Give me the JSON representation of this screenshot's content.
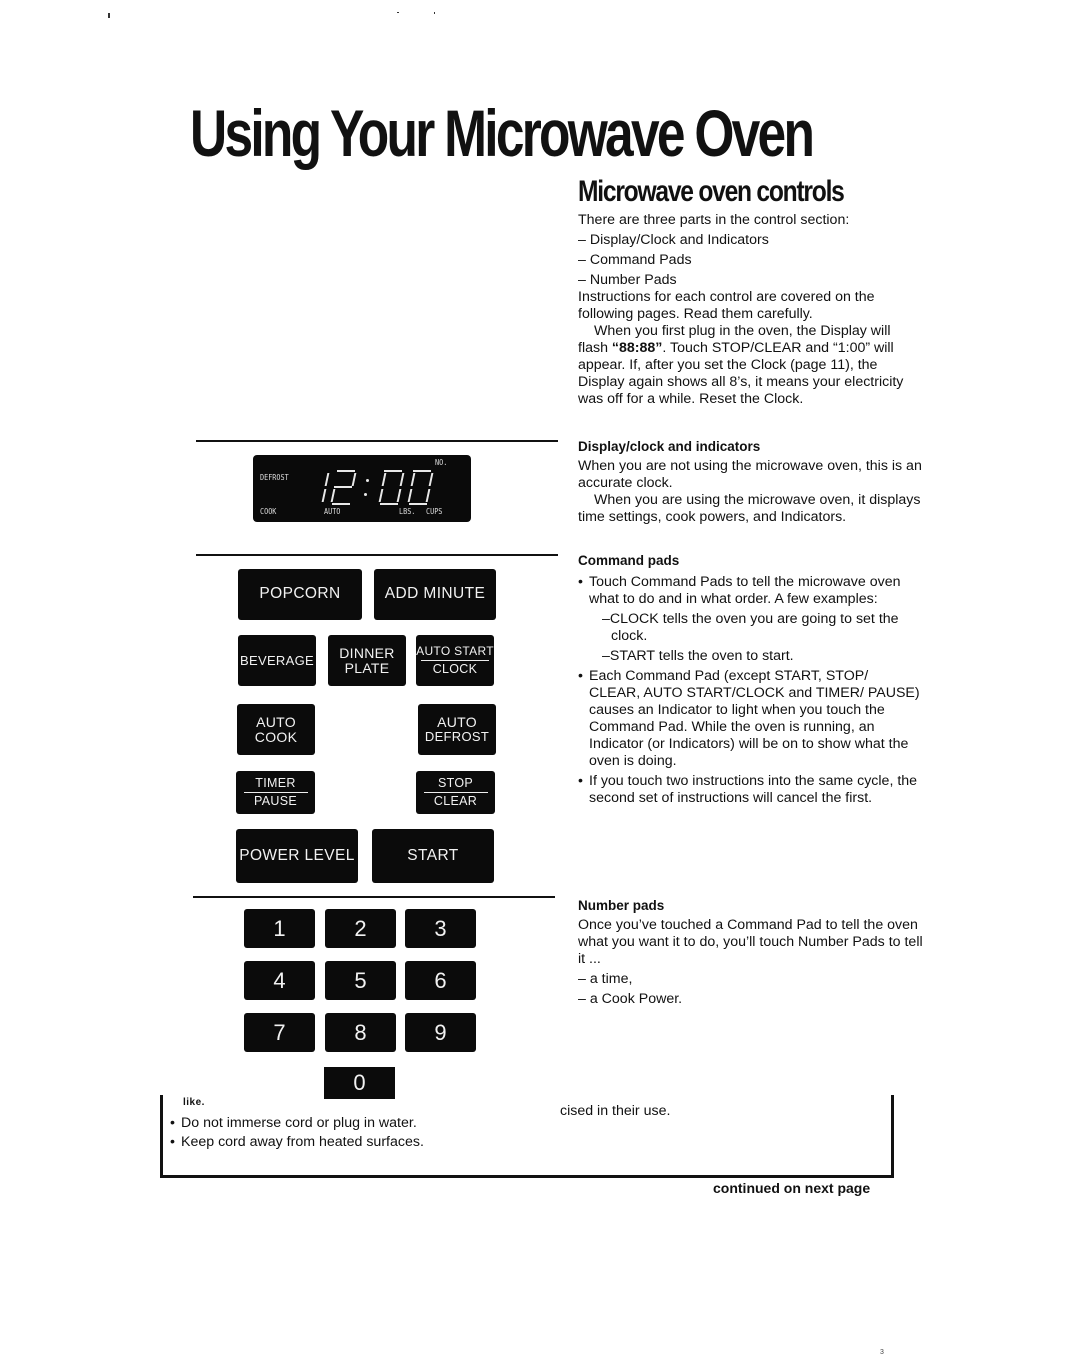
{
  "page": {
    "title": "Using Your Microwave Oven",
    "section_title": "Microwave oven controls",
    "page_number": "3"
  },
  "intro": {
    "lead": "There are three parts in the control section:",
    "parts": [
      "– Display/Clock and Indicators",
      "– Command Pads",
      "– Number Pads"
    ],
    "instructions": "Instructions for each control are covered on the following pages. Read them carefully.",
    "plug_in_prefix": "When you first plug in the oven, the Display will flash ",
    "plug_in_flash": "“88:88”",
    "plug_in_suffix": ". Touch STOP/CLEAR and “1:00” will appear. If, after you set the Clock (page 11), the Display again shows all 8’s, it means your electricity was off for a while. Reset the Clock."
  },
  "display_section": {
    "heading": "Display/clock and indicators",
    "para1": "When you are not using the microwave oven, this is an accurate clock.",
    "para2": "When you are using the microwave oven, it displays time settings, cook powers, and Indicators."
  },
  "command_section": {
    "heading": "Command pads",
    "bullet1": "Touch Command Pads to tell the microwave oven what to do and in what order. A few examples:",
    "examples": [
      "–CLOCK tells the oven you are going to set the clock.",
      "–START tells the oven to start."
    ],
    "bullet2": "Each Command Pad (except START, STOP/ CLEAR, AUTO START/CLOCK and TIMER/ PAUSE) causes an Indicator to light when you touch the Command Pad. While the oven is running, an Indicator (or Indicators) will be on to show what the oven is doing.",
    "bullet3": "If you touch two instructions into the same cycle, the second set of instructions will cancel the first."
  },
  "number_section": {
    "heading": "Number pads",
    "para": "Once you’ve touched a Command Pad to tell the oven what you want it to do, you’ll touch Number Pads to tell it ...",
    "items": [
      "– a time,",
      "– a Cook Power."
    ]
  },
  "display_panel": {
    "time": "12:00",
    "labels": {
      "defrost": "DEFROST",
      "cook": "COOK",
      "auto": "AUTO",
      "lbs": "LBS.",
      "cups": "CUPS",
      "no": "NO."
    }
  },
  "command_pads": {
    "popcorn": "POPCORN",
    "add_minute": "ADD MINUTE",
    "beverage": "BEVERAGE",
    "dinner_plate": [
      "DINNER",
      "PLATE"
    ],
    "auto_start_clock": [
      "AUTO START",
      "CLOCK"
    ],
    "auto_cook": [
      "AUTO",
      "COOK"
    ],
    "auto_defrost": [
      "AUTO",
      "DEFROST"
    ],
    "timer_pause": [
      "TIMER",
      "PAUSE"
    ],
    "stop_clear": [
      "STOP",
      "CLEAR"
    ],
    "power_level": "POWER LEVEL",
    "start": "START"
  },
  "number_pads": [
    "1",
    "2",
    "3",
    "4",
    "5",
    "6",
    "7",
    "8",
    "9",
    "0"
  ],
  "warning_box": {
    "fragment_left": "like.",
    "bullets": [
      "Do not immerse cord or plug in water.",
      "Keep cord away from heated surfaces."
    ],
    "fragment_right": "cised in their use."
  },
  "footer": {
    "continued": "continued on next page"
  }
}
